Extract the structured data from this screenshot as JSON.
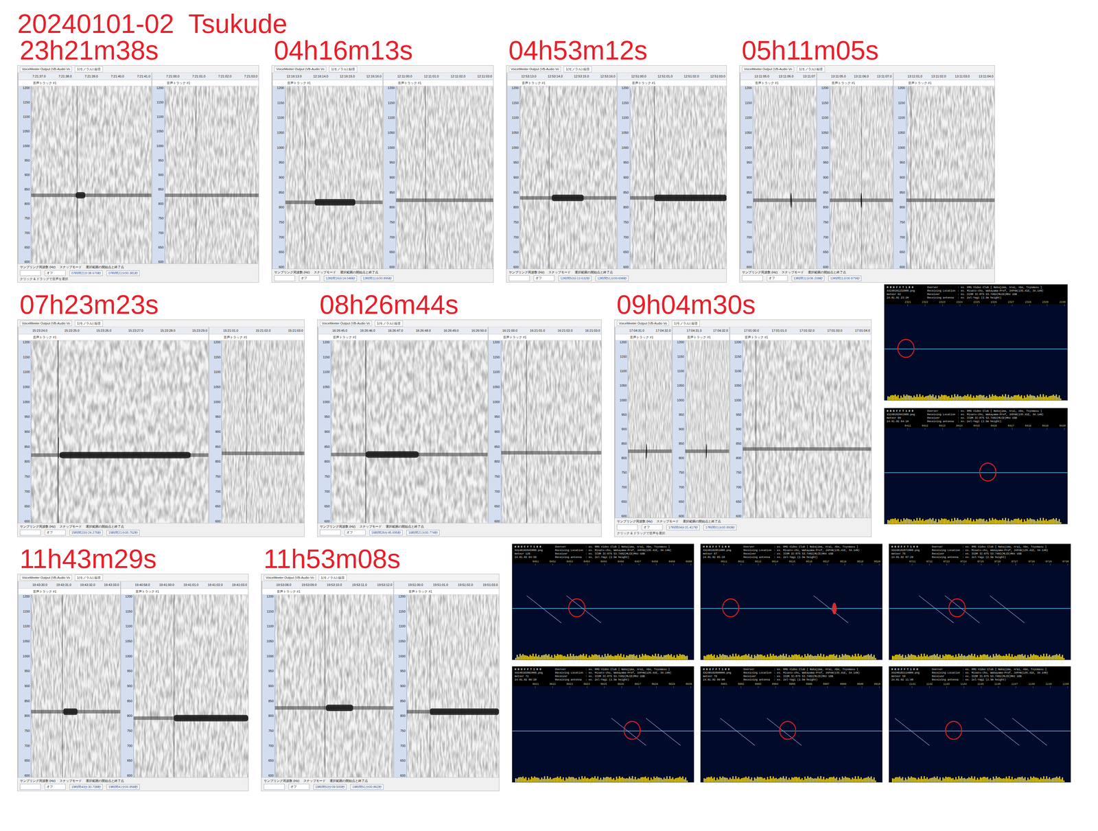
{
  "title": "20240101-02  Tsukude",
  "common": {
    "source": "VoiceMeeter Output (VB-Audio Vo",
    "channel": "1(モノラル) 録音",
    "track": "音声トラック #1",
    "freq_ticks": [
      "1200",
      "1150",
      "1100",
      "1050",
      "1000",
      "950",
      "900",
      "850",
      "800",
      "750",
      "700",
      "650",
      "600"
    ],
    "bottom_labels": [
      "サンプリング周波数 (Hz)",
      "スナップモード",
      "選択範囲の開始点と終了点"
    ],
    "snap": "オフ",
    "hint": "クリック & ドラッグで音声を選択"
  },
  "hrofft_common": {
    "logo": "H R O F F T 1 0 0",
    "meteor_label": "meteor",
    "fields": [
      {
        "label": "Overver",
        "value": ": ex. RMG Video Club [ Nakajima, Arai, Abe, Toyomasu ]"
      },
      {
        "label": "Receiving Location",
        "value": ": ex. Misato-cho, Wakayama-Pref, JAPAN(135.41E, 34.14N)"
      },
      {
        "label": "Receiver",
        "value": ": ex. ICOM IC-R75 53.7402(MLCD)MHz USB"
      },
      {
        "label": "Receiving antenna",
        "value": ": ex. 2el-Yagi (2.5m height)"
      }
    ]
  },
  "rows": [
    {
      "panels": [
        {
          "time": "23h21m38s",
          "hint": true,
          "tracks": [
            {
              "ticks": [
                "7:21:37.0",
                "7:21:38.0",
                "7:21:39.0",
                "7:21:40.0",
                "7:21:41.0"
              ],
              "carrier_hz": 828,
              "cursor": 0.38,
              "echoes": [
                {
                  "kind": "blob",
                  "start": 0.37,
                  "end": 0.45
                }
              ],
              "readout": "07時間21分38.670秒"
            },
            {
              "ticks": [
                "7:21:00.0",
                "7:21:01.0",
                "7:21:02.0",
                "7:21:03.0"
              ],
              "carrier_hz": 828,
              "cursor": 0.33,
              "echoes": [],
              "readout": "07時間21分00.381秒"
            }
          ]
        },
        {
          "time": "04h16m13s",
          "hint": false,
          "tracks": [
            {
              "ticks": [
                "12:16:13.0",
                "12:16:14.0",
                "12:16:15.0",
                "12:16:16.0"
              ],
              "carrier_hz": 815,
              "cursor": 0.2,
              "echoes": [
                {
                  "kind": "blob",
                  "start": 0.3,
                  "end": 0.72
                }
              ],
              "readout": "12時間16分14.048秒"
            },
            {
              "ticks": [
                "12:11:00.0",
                "12:11:01.0",
                "12:11:02.0",
                "12:11:03.0"
              ],
              "carrier_hz": 822,
              "cursor": 0.3,
              "echoes": [],
              "readout": "12時間11分00.895秒"
            }
          ]
        },
        {
          "time": "04h53m12s",
          "hint": false,
          "tracks": [
            {
              "ticks": [
                "12:53:13.0",
                "12:53:14.0",
                "12:53:15.0",
                "12:53:16.0"
              ],
              "carrier_hz": 830,
              "cursor": 0.3,
              "echoes": [
                {
                  "kind": "blob",
                  "start": 0.33,
                  "end": 0.66
                }
              ],
              "readout": "12時間53分13.632秒"
            },
            {
              "ticks": [
                "12:51:00.0",
                "12:51:01.0",
                "12:51:02.0",
                "12:51:03.0"
              ],
              "carrier_hz": 830,
              "cursor": 0.25,
              "echoes": [
                {
                  "kind": "blob",
                  "start": 0.25,
                  "end": 1.0
                }
              ],
              "readout": "12時間51分00.698秒"
            }
          ]
        },
        {
          "time": "05h11m05s",
          "hint": false,
          "tracks": [
            {
              "ticks": [
                "13:11:05.0",
                "13:11:06.0",
                "13:11:07"
              ],
              "carrier_hz": 822,
              "cursor": 0.6,
              "echoes": [
                {
                  "kind": "spike",
                  "start": 0.6,
                  "end": 0.6
                }
              ],
              "readout": "13時間11分06.208秒"
            },
            {
              "ticks": [
                "13:11:05.0",
                "13:11:06.0",
                "13:11:07.0"
              ],
              "carrier_hz": 822,
              "cursor": 0.5,
              "echoes": [
                {
                  "kind": "spike",
                  "start": 0.5,
                  "end": 0.5
                }
              ],
              "readout": ""
            },
            {
              "ticks": [
                "13:11:01.0",
                "13:11:02.0",
                "13:11:03.0",
                "13:11:04.0"
              ],
              "carrier_hz": 822,
              "cursor": 0.05,
              "echoes": [],
              "readout": "13時間11分00.879秒"
            }
          ]
        }
      ],
      "hrofft": []
    },
    {
      "panels": [
        {
          "time": "07h23m23s",
          "hint": false,
          "tracks": [
            {
              "ticks": [
                "15:23:24.0",
                "15:23:25.0",
                "15:23:26.0",
                "15:23:27.0",
                "15:23:28.0",
                "15:23:29.0"
              ],
              "carrier_hz": 820,
              "cursor": 0.15,
              "echoes": [
                {
                  "kind": "line",
                  "start": 0.15,
                  "end": 0.15
                },
                {
                  "kind": "blob",
                  "start": 0.16,
                  "end": 0.9
                }
              ],
              "readout": "15時間23分24.275秒"
            },
            {
              "ticks": [
                "15:21:01.0",
                "15:21:02.0",
                "15:21:03.0"
              ],
              "carrier_hz": 826,
              "cursor": 0.3,
              "echoes": [],
              "readout": "15時間21分00.752秒"
            }
          ]
        },
        {
          "time": "08h26m44s",
          "hint": false,
          "tracks": [
            {
              "ticks": [
                "16:26:45.0",
                "16:26:46.0",
                "16:26:47.0",
                "16:26:48.0",
                "16:26:49.0",
                "16:26:50.0"
              ],
              "carrier_hz": 822,
              "cursor": 0.22,
              "echoes": [
                {
                  "kind": "blob",
                  "start": 0.22,
                  "end": 0.56
                }
              ],
              "readout": "16時間26分45.695秒"
            },
            {
              "ticks": [
                "16:21:00.0",
                "16:21:01.0",
                "16:21:02.0",
                "16:21:03.0"
              ],
              "carrier_hz": 828,
              "cursor": 0.25,
              "echoes": [],
              "readout": "16時間21分00.774秒"
            }
          ]
        },
        {
          "time": "09h04m30s",
          "hint": true,
          "tracks": [
            {
              "ticks": [
                "17:04:31.0",
                "17:04:32.0"
              ],
              "carrier_hz": 822,
              "cursor": 0.4,
              "echoes": [
                {
                  "kind": "spike",
                  "start": 0.42,
                  "end": 0.42
                }
              ],
              "readout": ""
            },
            {
              "ticks": [
                "17:04:31.0",
                "17:04:32.0"
              ],
              "carrier_hz": 822,
              "cursor": 0.45,
              "echoes": [
                {
                  "kind": "spike",
                  "start": 0.48,
                  "end": 0.48
                }
              ],
              "readout": "17時間04分31.417秒"
            },
            {
              "ticks": [
                "17:01:00.0",
                "17:01:01.0",
                "17:01:02.0",
                "17:01:03.0",
                "17:01:04.0"
              ],
              "carrier_hz": 830,
              "cursor": 0.1,
              "echoes": [],
              "readout": "17時間01分00.893秒"
            }
          ]
        }
      ],
      "hrofft": [
        {
          "file": "XX240101232000.png",
          "meteor": "62",
          "date": "24.01.01 23:20",
          "ticks": [
            "2321",
            "2322",
            "2323",
            "2324",
            "2325",
            "2326",
            "2327",
            "2328",
            "2329",
            "2330"
          ],
          "marker": 0.9,
          "traces": [],
          "burst": null
        },
        {
          "file": "XX240102041000.png",
          "meteor": "60",
          "date": "24.01.02 04:10",
          "ticks": [
            "0411",
            "0412",
            "0413",
            "0414",
            "0415",
            "0416",
            "0417",
            "0418",
            "0419",
            "0420"
          ],
          "marker": 5.6,
          "traces": [],
          "burst": null
        }
      ]
    },
    {
      "panels": [
        {
          "time": "11h43m29s",
          "hint": false,
          "tracks": [
            {
              "ticks": [
                "19:43:30.0",
                "19:43:31.0",
                "19:43:32.0",
                "19:43:33.0"
              ],
              "carrier_hz": 812,
              "cursor": 0.35,
              "echoes": [
                {
                  "kind": "blob",
                  "start": 0.36,
                  "end": 0.52
                }
              ],
              "readout": "19時間43分30.708秒"
            },
            {
              "ticks": [
                "19:40:58.0",
                "19:41:00.0",
                "19:41:01.0",
                "19:41:02.0",
                "19:41:03.0"
              ],
              "carrier_hz": 790,
              "cursor": 0.35,
              "echoes": [
                {
                  "kind": "blob",
                  "start": 0.35,
                  "end": 1.0
                }
              ],
              "readout": "19時間41分00.858秒"
            }
          ]
        },
        {
          "time": "11h53m08s",
          "hint": false,
          "tracks": [
            {
              "ticks": [
                "19:53:08.0",
                "19:53:09.0",
                "19:53:10.0",
                "19:53:11.0",
                "19:53:12.0"
              ],
              "carrier_hz": 825,
              "cursor": 0.42,
              "echoes": [
                {
                  "kind": "blob",
                  "start": 0.43,
                  "end": 0.66
                }
              ],
              "readout": "19時間53分09.500秒"
            },
            {
              "ticks": [
                "19:51:00.0",
                "19:51:01.0",
                "19:51:02.0",
                "19:51:03.0"
              ],
              "carrier_hz": 812,
              "cursor": 0.25,
              "echoes": [
                {
                  "kind": "blob",
                  "start": 0.25,
                  "end": 1.0
                }
              ],
              "readout": "19時間51分00.862秒"
            }
          ]
        }
      ],
      "hrofft": [
        {
          "file": "XX240102045000.png",
          "meteor": "126",
          "date": "24.01.02 04:50",
          "ticks": [
            "0451",
            "0452",
            "0453",
            "0454",
            "0455",
            "0456",
            "0457",
            "0458",
            "0459",
            "0500"
          ],
          "marker": 3.4,
          "traces": [
            1.5,
            3.8
          ],
          "burst": null
        },
        {
          "file": "XX240102051000.png",
          "meteor": "87",
          "date": "24.01.02 05:10",
          "ticks": [
            "0511",
            "0512",
            "0513",
            "0514",
            "0515",
            "0516",
            "0517",
            "0518",
            "0519",
            "0520"
          ],
          "marker": 1.4,
          "traces": [
            7.2
          ],
          "burst": 7.4
        },
        {
          "file": "XX240102072000.png",
          "meteor": "76",
          "date": "24.01.02 07:20",
          "ticks": [
            "0721",
            "0722",
            "0723",
            "0724",
            "0725",
            "0726",
            "0727",
            "0728",
            "0729",
            "0730"
          ],
          "marker": 3.6,
          "traces": [
            2.4,
            3.9,
            6.5
          ],
          "burst": null
        },
        {
          "file": "XX240102082000.png",
          "meteor": "72",
          "date": "24.01.02 08:20",
          "ticks": [
            "0821",
            "0822",
            "0823",
            "0824",
            "0825",
            "0826",
            "0827",
            "0828",
            "0829",
            "0830"
          ],
          "marker": 6.6,
          "traces": [
            6.4,
            8.4
          ],
          "burst": null
        },
        {
          "file": "XX240102090000.png",
          "meteor": "78",
          "date": "24.01.02 09:00",
          "ticks": [
            "0901",
            "0902",
            "0903",
            "0904",
            "0905",
            "0906",
            "0907",
            "0908",
            "0909",
            "0910"
          ],
          "marker": 4.7,
          "traces": [
            1.8,
            4.5
          ],
          "burst": null
        },
        {
          "file": "XX240102114000.png",
          "meteor": "59",
          "date": "24.01.02 11:40",
          "ticks": [
            "1141",
            "1142",
            "1143",
            "1144",
            "1145",
            "1146",
            "1147",
            "1148",
            "1149",
            "1150"
          ],
          "marker": 3.4,
          "traces": [
            1.0,
            6.2,
            7.8
          ],
          "burst": null
        }
      ]
    }
  ]
}
